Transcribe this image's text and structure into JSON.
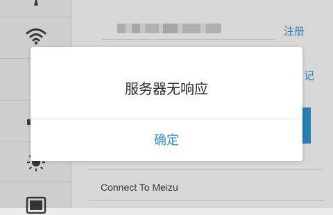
{
  "dialog": {
    "message": "服务器无响应",
    "confirm_label": "确定"
  },
  "background": {
    "register_link": "注册",
    "partial_link": "记",
    "wifi_name": "Connect To Meizu"
  },
  "sidebar": {
    "icons": [
      "signal-icon",
      "wifi-icon",
      "item-icon",
      "bar-icon",
      "brightness-icon",
      "battery-icon"
    ]
  },
  "colors": {
    "accent": "#2b8dc7",
    "dialog_bg": "#ffffff",
    "screen_bg": "#f0f0f0"
  }
}
